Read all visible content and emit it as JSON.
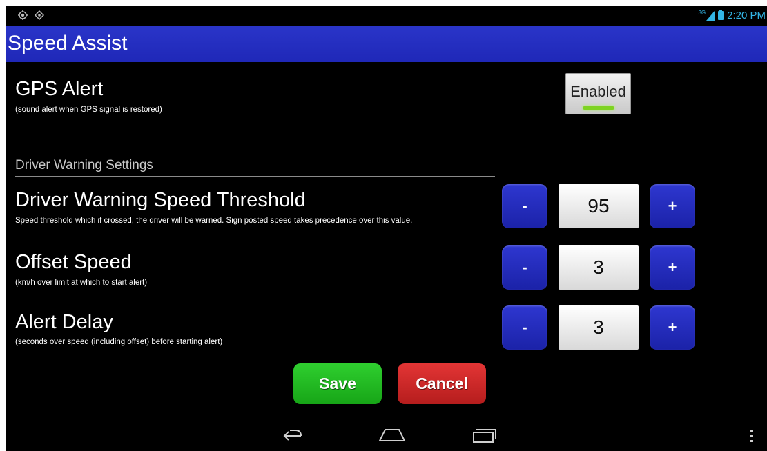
{
  "status_bar": {
    "left_icons": [
      "location-icon",
      "gps-icon"
    ],
    "network_label": "3G",
    "time": "2:20 PM",
    "accent_color": "#33b5e5"
  },
  "app": {
    "title": "Speed Assist",
    "title_bar_color": "#1f28b8"
  },
  "gps_alert": {
    "label": "GPS Alert",
    "description": "(sound alert when GPS signal is restored)",
    "toggle_label": "Enabled",
    "enabled": true
  },
  "section": {
    "header": "Driver Warning Settings"
  },
  "settings": [
    {
      "label": "Driver Warning Speed Threshold",
      "description": "Speed threshold which if crossed, the driver will be warned. Sign posted speed takes precedence over this value.",
      "value": "95",
      "decrement_label": "-",
      "increment_label": "+"
    },
    {
      "label": "Offset Speed",
      "description": "(km/h over limit at which to start alert)",
      "value": "3",
      "decrement_label": "-",
      "increment_label": "+"
    },
    {
      "label": "Alert Delay",
      "description": "(seconds over speed (including offset) before starting alert)",
      "value": "3",
      "decrement_label": "-",
      "increment_label": "+"
    }
  ],
  "actions": {
    "save_label": "Save",
    "save_color": "#1fb51f",
    "cancel_label": "Cancel",
    "cancel_color": "#c72626"
  },
  "nav_bar": {
    "icons": [
      "back-icon",
      "home-icon",
      "recent-apps-icon",
      "overflow-menu-icon"
    ]
  }
}
